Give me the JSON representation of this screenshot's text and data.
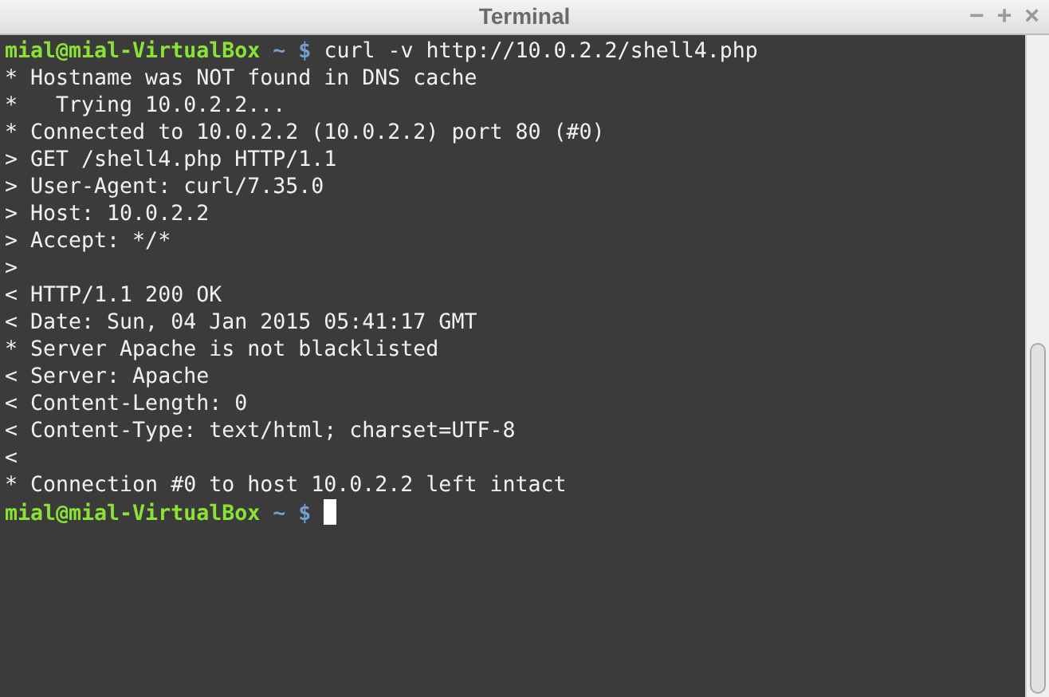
{
  "window": {
    "title": "Terminal",
    "controls": [
      "−",
      "+",
      "×"
    ]
  },
  "lines": [
    {
      "kind": "prompt",
      "user_host": "mial@mial-VirtualBox",
      "path": "~",
      "symbol": "$",
      "command": "curl -v http://10.0.2.2/shell4.php",
      "cursor": false
    },
    {
      "kind": "output",
      "text": "* Hostname was NOT found in DNS cache"
    },
    {
      "kind": "output",
      "text": "*   Trying 10.0.2.2..."
    },
    {
      "kind": "output",
      "text": "* Connected to 10.0.2.2 (10.0.2.2) port 80 (#0)"
    },
    {
      "kind": "output",
      "text": "> GET /shell4.php HTTP/1.1"
    },
    {
      "kind": "output",
      "text": "> User-Agent: curl/7.35.0"
    },
    {
      "kind": "output",
      "text": "> Host: 10.0.2.2"
    },
    {
      "kind": "output",
      "text": "> Accept: */*"
    },
    {
      "kind": "output",
      "text": ">"
    },
    {
      "kind": "output",
      "text": "< HTTP/1.1 200 OK"
    },
    {
      "kind": "output",
      "text": "< Date: Sun, 04 Jan 2015 05:41:17 GMT"
    },
    {
      "kind": "output",
      "text": "* Server Apache is not blacklisted"
    },
    {
      "kind": "output",
      "text": "< Server: Apache"
    },
    {
      "kind": "output",
      "text": "< Content-Length: 0"
    },
    {
      "kind": "output",
      "text": "< Content-Type: text/html; charset=UTF-8"
    },
    {
      "kind": "output",
      "text": "<"
    },
    {
      "kind": "output",
      "text": "* Connection #0 to host 10.0.2.2 left intact"
    },
    {
      "kind": "prompt",
      "user_host": "mial@mial-VirtualBox",
      "path": "~",
      "symbol": "$",
      "cursor": true
    }
  ]
}
